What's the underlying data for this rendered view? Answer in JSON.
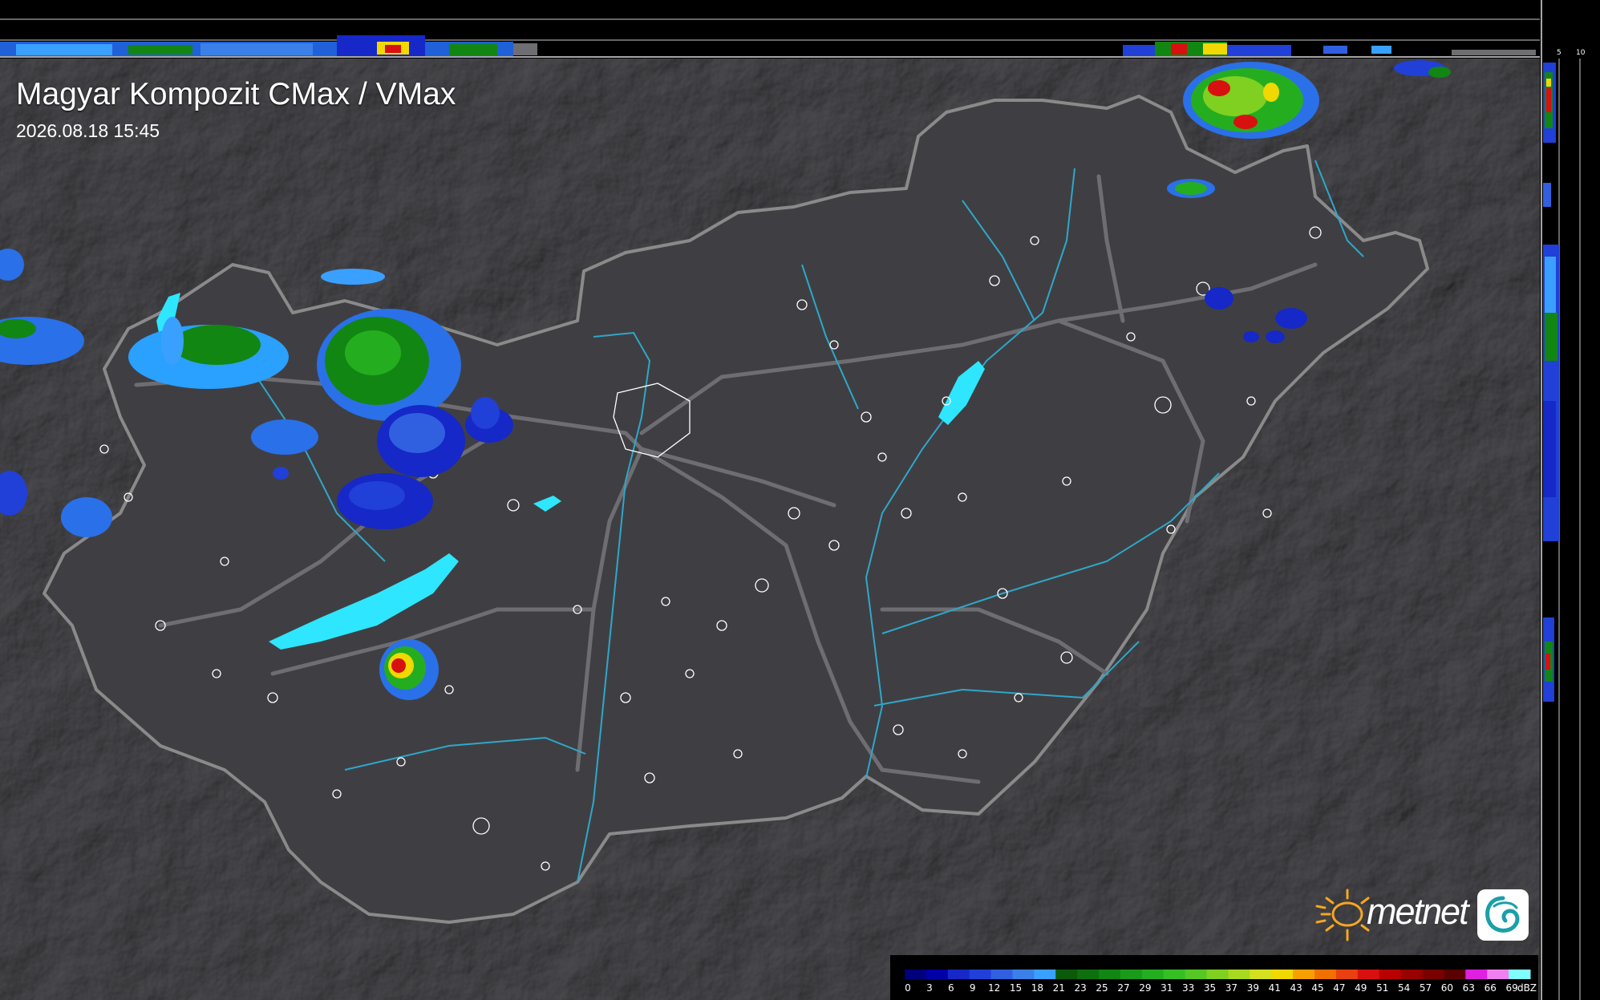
{
  "map": {
    "title": "Magyar Kompozit CMax / VMax",
    "timestamp": "2026.08.18 15:45"
  },
  "top_strip_ticks": [
    "10",
    "5"
  ],
  "side_strip_ticks": [
    "5",
    "10"
  ],
  "brand": {
    "name": "metnet",
    "logo_color": "#f5a623"
  },
  "colors": {
    "background": "#3a3a3c",
    "terrain": "#333336",
    "country_land": "#3f3f43",
    "border": "#8a8a8a",
    "roads": "#6e6e72",
    "rivers": "#2fa7c9",
    "lakes": "#2ee6ff",
    "city_outline": "#ffffff"
  },
  "legend": {
    "unit": "dBZ",
    "labels": [
      "0",
      "3",
      "6",
      "9",
      "12",
      "15",
      "18",
      "21",
      "23",
      "25",
      "27",
      "29",
      "31",
      "33",
      "35",
      "37",
      "39",
      "41",
      "43",
      "45",
      "47",
      "49",
      "51",
      "54",
      "57",
      "60",
      "63",
      "66",
      "69"
    ],
    "colors": [
      "#00007a",
      "#0000a8",
      "#1628c8",
      "#2040d8",
      "#3060e0",
      "#3a80e8",
      "#3aa0ff",
      "#0a5a0a",
      "#0d700d",
      "#128612",
      "#1a9a1a",
      "#25ad20",
      "#35bf25",
      "#55c825",
      "#7fd020",
      "#a8d820",
      "#d4e020",
      "#f0d800",
      "#f5a000",
      "#f07000",
      "#e84010",
      "#d81010",
      "#b80000",
      "#980000",
      "#7a0000",
      "#5a0000",
      "#e020e0",
      "#f080f0",
      "#80ffff"
    ]
  }
}
